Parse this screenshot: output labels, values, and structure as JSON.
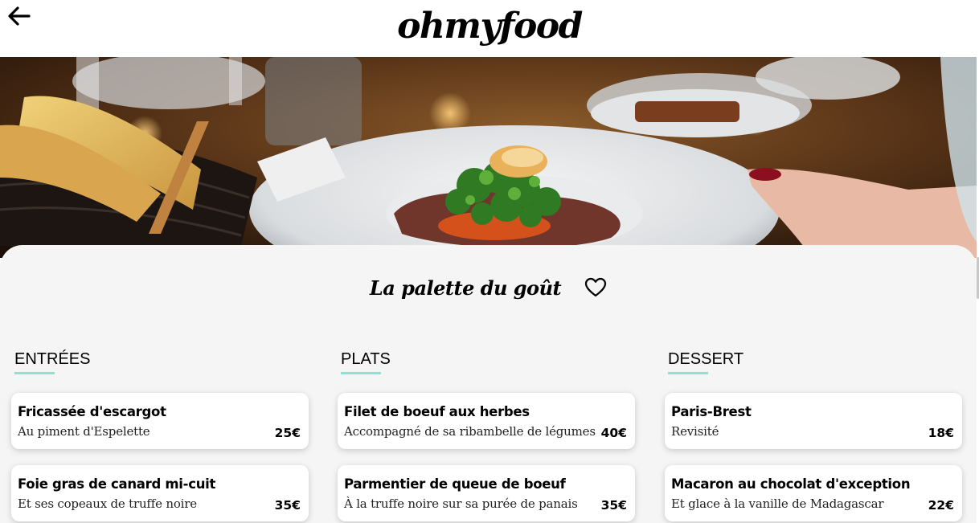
{
  "header": {
    "logo": "ohmyfood",
    "back_icon": "arrow-left-icon"
  },
  "hero": {
    "alt_subject": "plated dish on restaurant table"
  },
  "restaurant": {
    "name": "La palette du goût",
    "favorite_icon": "heart-outline-icon"
  },
  "menu": {
    "sections": [
      {
        "title": "ENTRÉES",
        "items": [
          {
            "name": "Fricassée d'escargot",
            "desc": "Au piment d'Espelette",
            "price": "25€"
          },
          {
            "name": "Foie gras de canard mi-cuit",
            "desc": "Et ses copeaux de truffe noire",
            "price": "35€"
          }
        ]
      },
      {
        "title": "PLATS",
        "items": [
          {
            "name": "Filet de boeuf aux herbes",
            "desc": "Accompagné de sa ribambelle de légumes",
            "price": "40€"
          },
          {
            "name": "Parmentier de queue de boeuf",
            "desc": "À la truffe noire sur sa purée de panais",
            "price": "35€"
          }
        ]
      },
      {
        "title": "DESSERT",
        "items": [
          {
            "name": "Paris-Brest",
            "desc": "Revisité",
            "price": "18€"
          },
          {
            "name": "Macaron au chocolat d'exception",
            "desc": "Et glace à la vanille de Madagascar",
            "price": "22€"
          }
        ]
      }
    ]
  },
  "colors": {
    "accent": "#8fe0cf",
    "panel": "#f5f5f5"
  }
}
